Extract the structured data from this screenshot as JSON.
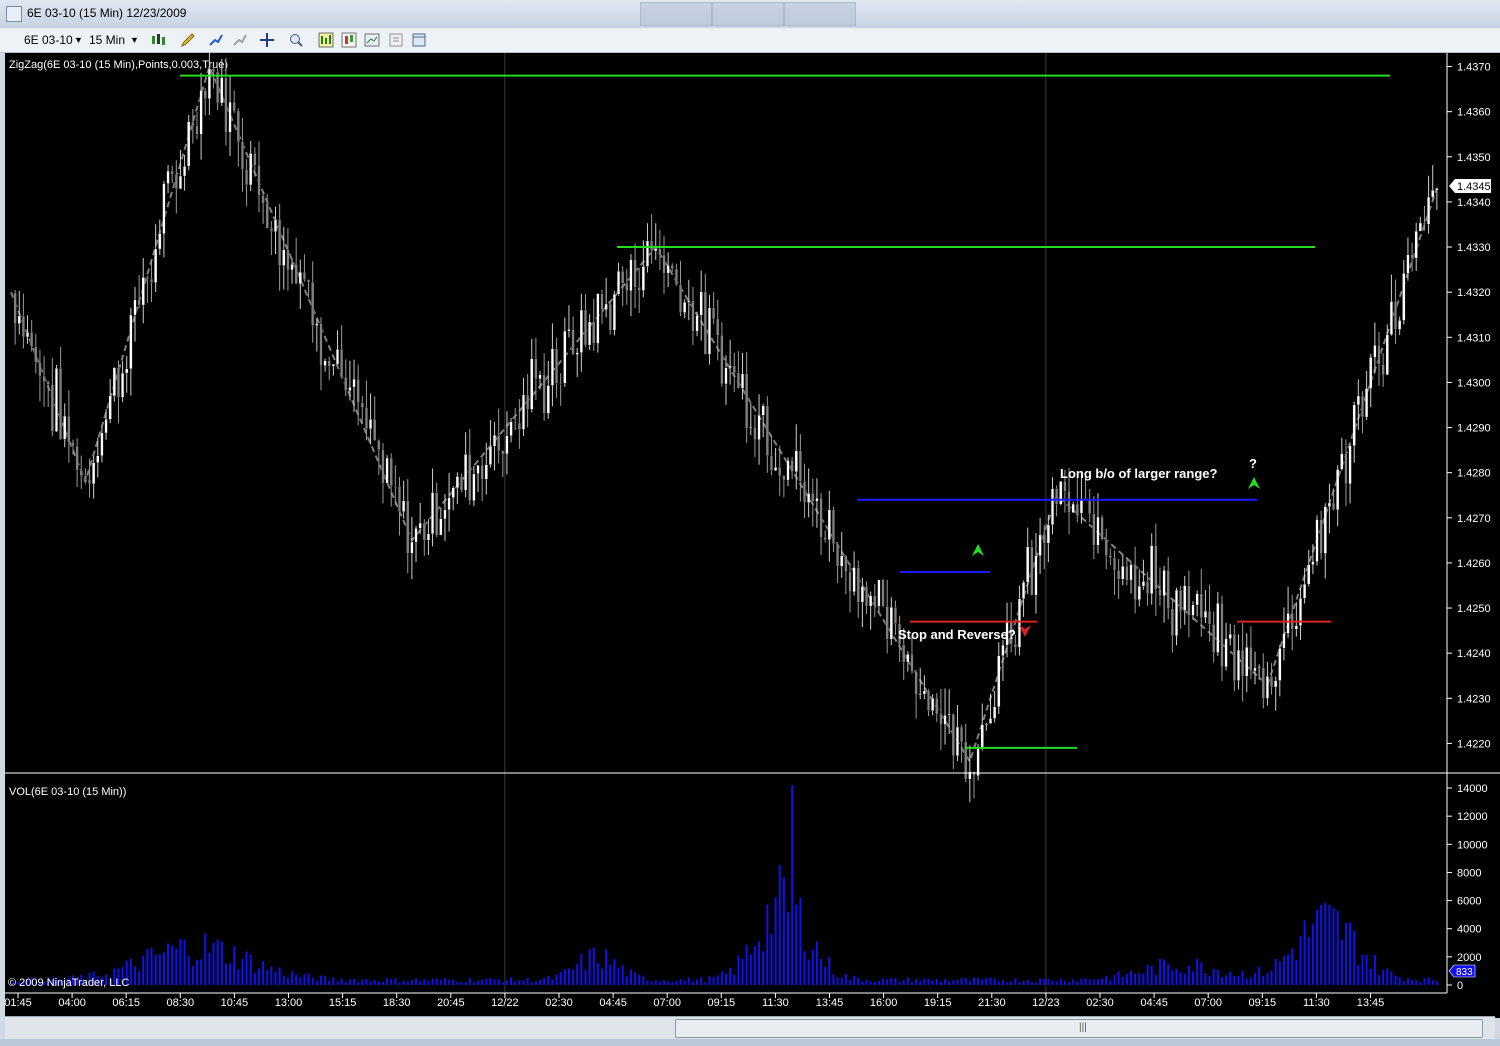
{
  "window": {
    "title": "6E 03-10 (15 Min)  12/23/2009"
  },
  "toolbar": {
    "instrument": "6E 03-10",
    "interval": "15 Min",
    "icons": [
      "bar-type-icon",
      "pencil-draw-icon",
      "indicator-icon",
      "strategy-icon",
      "crosshair-icon",
      "zoom-icon",
      "data-series-icon",
      "candlestick-icon",
      "chart-style-icon",
      "properties-icon",
      "layout-icon"
    ]
  },
  "colors": {
    "background": "#000000",
    "up": "#ffffff",
    "down": "#808080",
    "zigzag": "#808080",
    "green_line": "#22dd22",
    "blue_line": "#1a1aff",
    "red_line": "#dd2222",
    "volume": "#1111ee"
  },
  "chart_data": [
    {
      "type": "candlestick",
      "indicator_label": "ZigZag(6E 03-10 (15 Min),Points,0.003,True)",
      "ylim": [
        1.4213,
        1.4373
      ],
      "y_ticks": [
        "1.4370",
        "1.4360",
        "1.4350",
        "1.4340",
        "1.4330",
        "1.4320",
        "1.4310",
        "1.4300",
        "1.4290",
        "1.4280",
        "1.4270",
        "1.4260",
        "1.4250",
        "1.4240",
        "1.4230",
        "1.4220"
      ],
      "last_price": "1.4345",
      "x_ticks": [
        "01:45",
        "04:00",
        "06:15",
        "08:30",
        "10:45",
        "13:00",
        "15:15",
        "18:30",
        "20:45",
        "12/22",
        "02:30",
        "04:45",
        "07:00",
        "09:15",
        "11:30",
        "13:45",
        "16:00",
        "19:15",
        "21:30",
        "12/23",
        "02:30",
        "04:45",
        "07:00",
        "09:15",
        "11:30",
        "13:45"
      ],
      "session_breaks": [
        "12/22",
        "12/23"
      ],
      "zigzag_pivots": [
        1.432,
        1.4278,
        1.437,
        1.4265,
        1.433,
        1.4216,
        1.4275,
        1.4233,
        1.4343
      ],
      "horizontal_lines": [
        {
          "color": "green",
          "price": 1.4368
        },
        {
          "color": "green",
          "price": 1.433
        },
        {
          "color": "green",
          "price": 1.4219
        },
        {
          "color": "blue",
          "price": 1.4274
        },
        {
          "color": "blue",
          "price": 1.4258
        },
        {
          "color": "red",
          "price": 1.4247
        },
        {
          "color": "red",
          "price": 1.4247
        }
      ],
      "annotations": [
        {
          "text": "Long b/o of larger range?"
        },
        {
          "text": "?"
        },
        {
          "text": "Stop and Reverse?"
        }
      ]
    },
    {
      "type": "bar",
      "indicator_label": "VOL(6E 03-10 (15 Min))",
      "ylim": [
        0,
        14500
      ],
      "y_ticks": [
        "14000",
        "12000",
        "10000",
        "8000",
        "6000",
        "4000",
        "2000",
        "0"
      ],
      "last_value": "833"
    }
  ],
  "copyright": "© 2009 NinjaTrader, LLC"
}
